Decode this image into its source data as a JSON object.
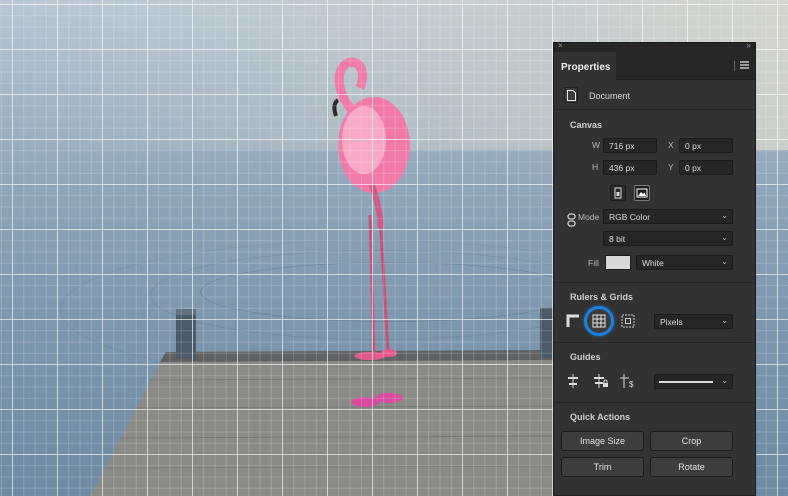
{
  "canvas": {
    "image_subject": "flamingo-on-dock",
    "grid_visible": true
  },
  "panel": {
    "tab_title": "Properties",
    "document_label": "Document",
    "canvas_section": {
      "title": "Canvas",
      "width_label": "W",
      "width_value": "716 px",
      "height_label": "H",
      "height_value": "436 px",
      "x_label": "X",
      "x_value": "0 px",
      "y_label": "Y",
      "y_value": "0 px",
      "mode_label": "Mode",
      "mode_value": "RGB Color",
      "bit_value": "8 bit",
      "fill_label": "Fill",
      "fill_value": "White",
      "fill_color": "#d9d9d9"
    },
    "rulers_section": {
      "title": "Rulers & Grids",
      "units_value": "Pixels",
      "highlight_color": "#1a7fe0"
    },
    "guides_section": {
      "title": "Guides"
    },
    "quick_actions": {
      "title": "Quick Actions",
      "buttons": [
        "Image Size",
        "Crop",
        "Trim",
        "Rotate"
      ]
    }
  }
}
